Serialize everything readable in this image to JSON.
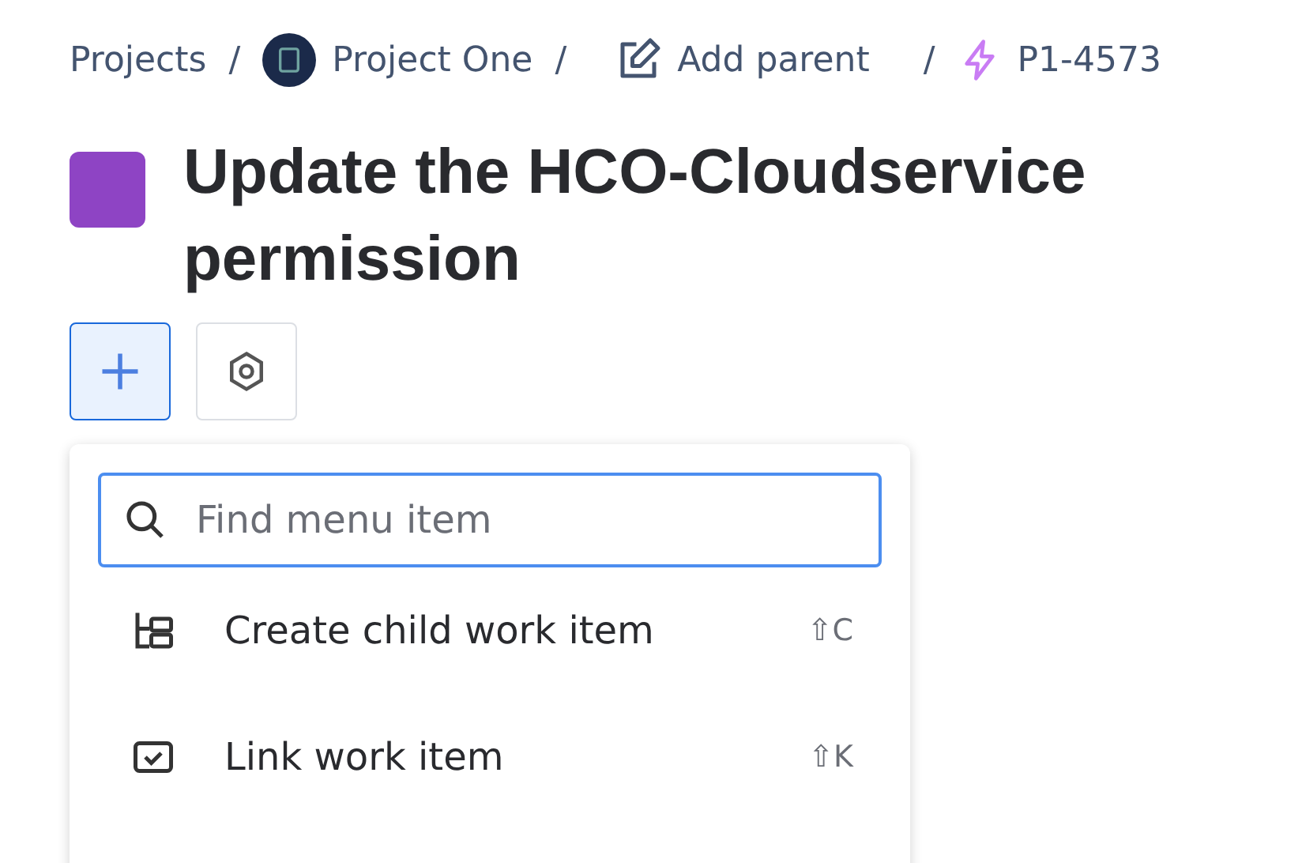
{
  "breadcrumbs": [
    {
      "kind": "link",
      "label": "Projects"
    },
    {
      "kind": "project",
      "separator": "/",
      "label": "Project One"
    },
    {
      "kind": "add-parent",
      "separator": "/",
      "label": "Add parent"
    },
    {
      "kind": "work-item",
      "separator": "/",
      "label": "P1-4573"
    }
  ],
  "title": {
    "color": "#8e44c4",
    "lines": [
      "Update the HCO-Cloudservice",
      "permission"
    ]
  },
  "toolbar": {
    "add_selected": true
  },
  "menu": {
    "search": {
      "placeholder": "Find menu item"
    },
    "items": [
      {
        "kind": "child",
        "label": "Create child work item",
        "shortcut": "⇧C"
      },
      {
        "kind": "link",
        "label": "Link work item",
        "shortcut": "⇧K"
      }
    ]
  }
}
